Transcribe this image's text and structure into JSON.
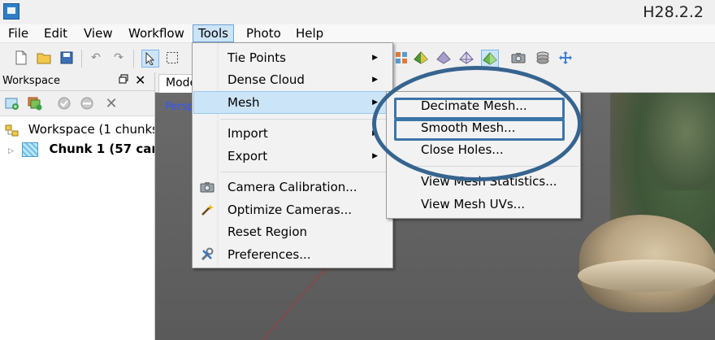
{
  "window": {
    "title": "H28.2.2"
  },
  "menubar": {
    "items": [
      {
        "id": "file",
        "label": "File"
      },
      {
        "id": "edit",
        "label": "Edit"
      },
      {
        "id": "view",
        "label": "View"
      },
      {
        "id": "workflow",
        "label": "Workflow"
      },
      {
        "id": "tools",
        "label": "Tools"
      },
      {
        "id": "photo",
        "label": "Photo"
      },
      {
        "id": "help",
        "label": "Help"
      }
    ]
  },
  "workspace": {
    "title": "Workspace",
    "tree": {
      "root": "Workspace (1 chunks",
      "chunk": "Chunk 1 (57 cam"
    }
  },
  "view": {
    "tab": "Mode",
    "overlay": "Persp"
  },
  "tools_menu": {
    "items": [
      {
        "label": "Tie Points",
        "submenu": true
      },
      {
        "label": "Dense Cloud",
        "submenu": true
      },
      {
        "label": "Mesh",
        "submenu": true,
        "highlighted": true
      },
      {
        "label": "Import",
        "submenu": true
      },
      {
        "label": "Export",
        "submenu": true
      },
      {
        "label": "Camera Calibration...",
        "icon": "camera-icon"
      },
      {
        "label": "Optimize Cameras...",
        "icon": "wand-icon"
      },
      {
        "label": "Reset Region"
      },
      {
        "label": "Preferences...",
        "icon": "tools-icon"
      }
    ]
  },
  "mesh_menu": {
    "items": [
      {
        "label": "Decimate Mesh...",
        "boxed": true
      },
      {
        "label": "Smooth Mesh...",
        "boxed": true
      },
      {
        "label": "Close Holes..."
      },
      {
        "label": "View Mesh Statistics..."
      },
      {
        "label": "View Mesh UVs..."
      }
    ]
  },
  "colors": {
    "menu_highlight": "#cce4f7",
    "annotation": "#36648f",
    "viewport_bg": "#5e5e5e"
  }
}
